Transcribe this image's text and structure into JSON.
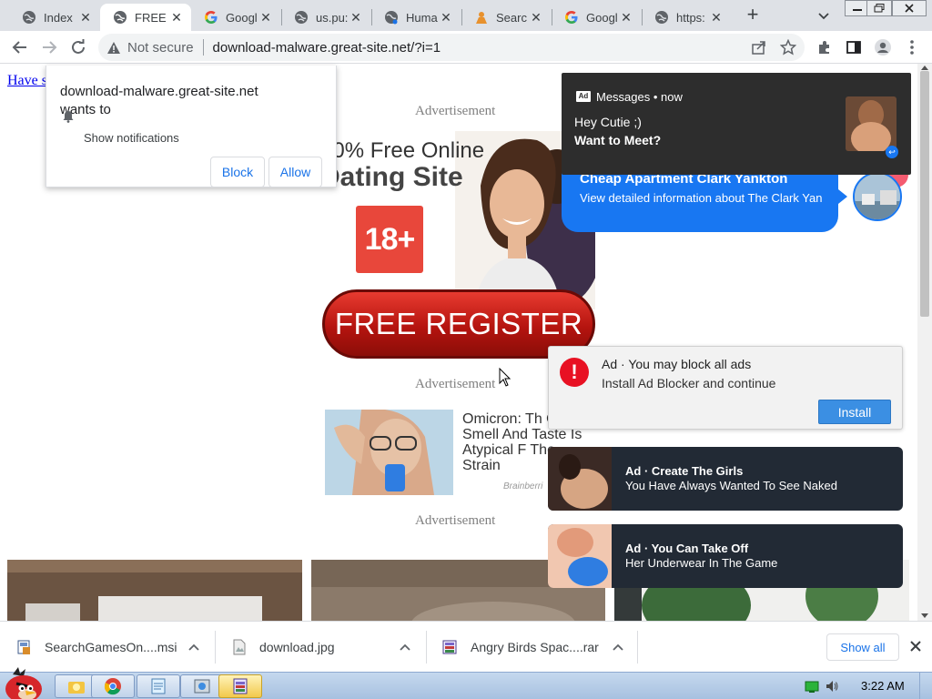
{
  "tabs": [
    {
      "title": "Index",
      "icon": "globe-icon",
      "active": false
    },
    {
      "title": "FREE I",
      "icon": "globe-icon",
      "active": true
    },
    {
      "title": "Googl",
      "icon": "google-icon",
      "active": false
    },
    {
      "title": "us.pu:",
      "icon": "globe-icon",
      "active": false
    },
    {
      "title": "Huma",
      "icon": "globe-icon",
      "active": false
    },
    {
      "title": "Searc",
      "icon": "person-icon",
      "active": false
    },
    {
      "title": "Googl",
      "icon": "google-icon",
      "active": false
    },
    {
      "title": "https:",
      "icon": "globe-icon",
      "active": false
    }
  ],
  "toolbar": {
    "security_label": "Not secure",
    "url": "download-malware.great-site.net/?i=1"
  },
  "permission_prompt": {
    "host": "download-malware.great-site.net",
    "wants": "wants to",
    "request": "Show notifications",
    "block_label": "Block",
    "allow_label": "Allow"
  },
  "page": {
    "top_link": "Have s",
    "ad_label": "Advertisement",
    "dating": {
      "line1": "00% Free Online",
      "line2": "Dating Site",
      "badge": "18+",
      "register_label": "FREE REGISTER"
    },
    "news": {
      "headline": "Omicron: Th Of Smell And Taste Is Atypical F The Strain",
      "source": "Brainberri"
    }
  },
  "notifications": {
    "messages": {
      "header": "Messages • now",
      "line1": "Hey Cutie ;)",
      "line2": "Want to Meet?"
    },
    "bubble": {
      "title": "Cheap Apartment Clark Yankton",
      "body": "View detailed information about The Clark Yan"
    },
    "block_ads": {
      "title": "Ad · You may block all ads",
      "body": "Install Ad Blocker and continue",
      "install_label": "Install"
    },
    "dark_ads": [
      {
        "title": "Ad · Create The Girls",
        "body": "You Have Always Wanted To See Naked"
      },
      {
        "title": "Ad · You Can Take Off",
        "body": "Her Underwear In The Game"
      }
    ]
  },
  "downloads": {
    "items": [
      {
        "name": "SearchGamesOn....msi",
        "icon": "installer-icon"
      },
      {
        "name": "download.jpg",
        "icon": "image-file-icon"
      },
      {
        "name": "Angry Birds Spac....rar",
        "icon": "archive-icon"
      }
    ],
    "show_all_label": "Show all"
  },
  "taskbar": {
    "clock": "3:22 AM"
  },
  "colors": {
    "accent_blue": "#1a73e8",
    "messenger_blue": "#1877f2",
    "register_red": "#c8170f",
    "notif_dark": "#2d2d2d"
  }
}
